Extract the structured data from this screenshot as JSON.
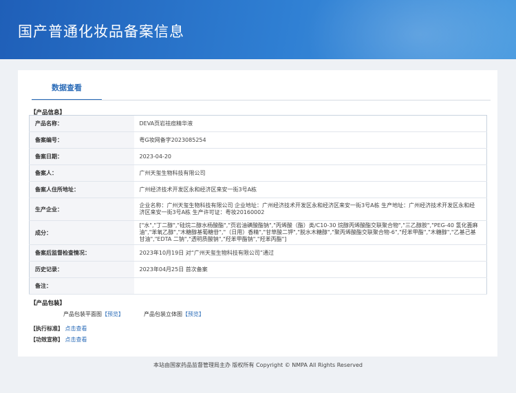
{
  "header": {
    "title": "国产普通化妆品备案信息"
  },
  "tab": {
    "label": "数据查看"
  },
  "product_info": {
    "section_title": "【产品信息】",
    "rows": [
      {
        "label": "产品名称：",
        "value": "DEVA页岩祛痘精华液"
      },
      {
        "label": "备案编号：",
        "value": "粤G妆网备字2023085254"
      },
      {
        "label": "备案日期：",
        "value": "2023-04-20"
      },
      {
        "label": "备案人：",
        "value": "广州天玺生物科技有限公司"
      },
      {
        "label": "备案人住所地址：",
        "value": "广州经济技术开发区永和经济区来安一街3号A栋"
      },
      {
        "label": "生产企业：",
        "value": "企业名称：广州天玺生物科技有限公司 企业地址：广州经济技术开发区永和经济区来安一街3号A栋 生产地址：广州经济技术开发区永和经济区来安一街3号A栋 生产许可证：粤妆20160002"
      },
      {
        "label": "成分：",
        "value": "[\"水\",\"丁二醇\",\"硅烷二醇水杨酸酯\",\"页岩油磺酸酯钠\",\"丙烯酸（酯）类/C10-30 烷醇丙烯酸酯交联聚合物\",\"三乙醇胺\",\"PEG-40 氢化蓖麻油\",\"苯氧乙醇\",\"木糖醇基葡糖苷\",\"（日用）香精\",\"甘草酸二钾\",\"脱水木糖醇\",\"聚丙烯酸酯交联聚合物-6\",\"羟苯甲酯\",\"木糖醇\",\"乙基己基甘油\",\"EDTA 二钠\",\"透明质酸钠\",\"羟苯甲酯钠\",\"羟苯丙酯\"]"
      },
      {
        "label": "备案后监督检查情况：",
        "value": "2023年10月19日 对“广州天玺生物科技有限公司”通过"
      },
      {
        "label": "历史记录：",
        "value": "2023年04月25日 首次备案"
      },
      {
        "label": "备注：",
        "value": ""
      }
    ]
  },
  "packaging": {
    "section_title": "【产品包装】",
    "flat_label": "产品包装平面图",
    "flat_link": "【预览】",
    "3d_label": "产品包装立体图",
    "3d_link": "【预览】"
  },
  "standard": {
    "label": "【执行标准】",
    "link": "点击查看"
  },
  "efficacy": {
    "label": "【功效宣称】",
    "link": "点击查看"
  },
  "footer": {
    "text": "本站由国家药品监督管理局主办 版权所有 Copyright © NMPA All Rights Reserved"
  }
}
